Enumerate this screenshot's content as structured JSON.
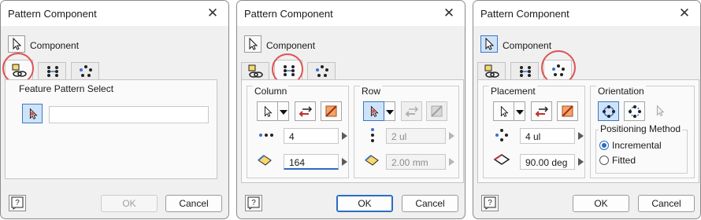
{
  "dialogs": [
    {
      "title": "Pattern Component",
      "component_label": "Component",
      "tabs": [
        "rectangular-pattern",
        "circular-pattern",
        "feature-pattern-select"
      ],
      "active_tab": "feature-pattern-select",
      "feature_pattern_select": {
        "heading": "Feature Pattern Select",
        "value": ""
      },
      "buttons": {
        "ok": "OK",
        "cancel": "Cancel"
      }
    },
    {
      "title": "Pattern Component",
      "component_label": "Component",
      "active_tab": "rectangular-pattern",
      "column": {
        "heading": "Column",
        "count": "4",
        "spacing": "164"
      },
      "row": {
        "heading": "Row",
        "count": "2 ul",
        "spacing": "2.00 mm"
      },
      "buttons": {
        "ok": "OK",
        "cancel": "Cancel"
      }
    },
    {
      "title": "Pattern Component",
      "component_label": "Component",
      "active_tab": "circular-pattern",
      "placement": {
        "heading": "Placement",
        "count": "4 ul",
        "angle": "90.00 deg"
      },
      "orientation": {
        "heading": "Orientation"
      },
      "positioning": {
        "heading": "Positioning Method",
        "options": [
          "Incremental",
          "Fitted"
        ],
        "selected": "Incremental"
      },
      "buttons": {
        "ok": "OK",
        "cancel": "Cancel"
      }
    }
  ],
  "colors": {
    "highlight_ring": "#e05252",
    "accent": "#2b6cc4",
    "pressed_bg": "#cfe3f8"
  }
}
